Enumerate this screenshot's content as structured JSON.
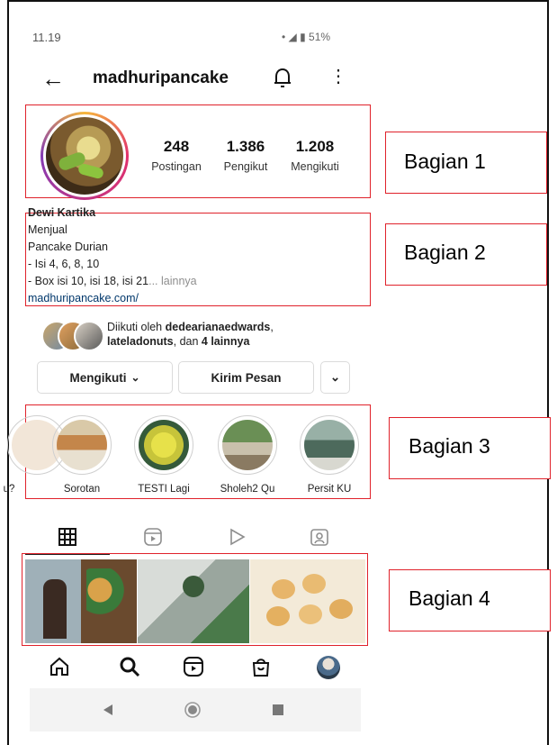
{
  "status": {
    "time": "11.19",
    "indicators": "• ◢ ▮ 51%"
  },
  "topbar": {
    "username": "madhuripancake",
    "back_icon": "arrow-left-icon",
    "bell_icon": "bell-icon",
    "menu_icon": "more-vertical-icon"
  },
  "stats": [
    {
      "value": "248",
      "label": "Postingan"
    },
    {
      "value": "1.386",
      "label": "Pengikut"
    },
    {
      "value": "1.208",
      "label": "Mengikuti"
    }
  ],
  "bio": {
    "name": "Dewi Kartika",
    "lines": [
      "Menjual",
      "Pancake Durian",
      "- Isi 4, 6, 8, 10"
    ],
    "last_line": "- Box isi 10, isi 18, isi 21",
    "more": "... lainnya",
    "link": "madhuripancake.com/"
  },
  "followed_by": {
    "prefix": "Diikuti oleh ",
    "user1": "dedearianaedwards",
    "sep": ",",
    "user2": "lateladonuts",
    "mid": ", dan ",
    "rest": "4 lainnya"
  },
  "buttons": {
    "following": "Mengikuti",
    "message": "Kirim Pesan",
    "chevron": "⌄"
  },
  "highlights": [
    "u?",
    "Sorotan",
    "TESTI Lagi",
    "Sholeh2 Qu",
    "Persit KU"
  ],
  "tabs": [
    "grid-icon",
    "reels-icon",
    "play-icon",
    "tagged-icon"
  ],
  "annotations": [
    "Bagian 1",
    "Bagian 2",
    "Bagian 3",
    "Bagian 4"
  ],
  "bottom_nav": [
    "home-icon",
    "search-icon",
    "reels-icon",
    "shop-icon",
    "profile-avatar"
  ],
  "colors": {
    "annotation_red": "#e0222b",
    "link": "#00376b",
    "text": "#262626"
  }
}
